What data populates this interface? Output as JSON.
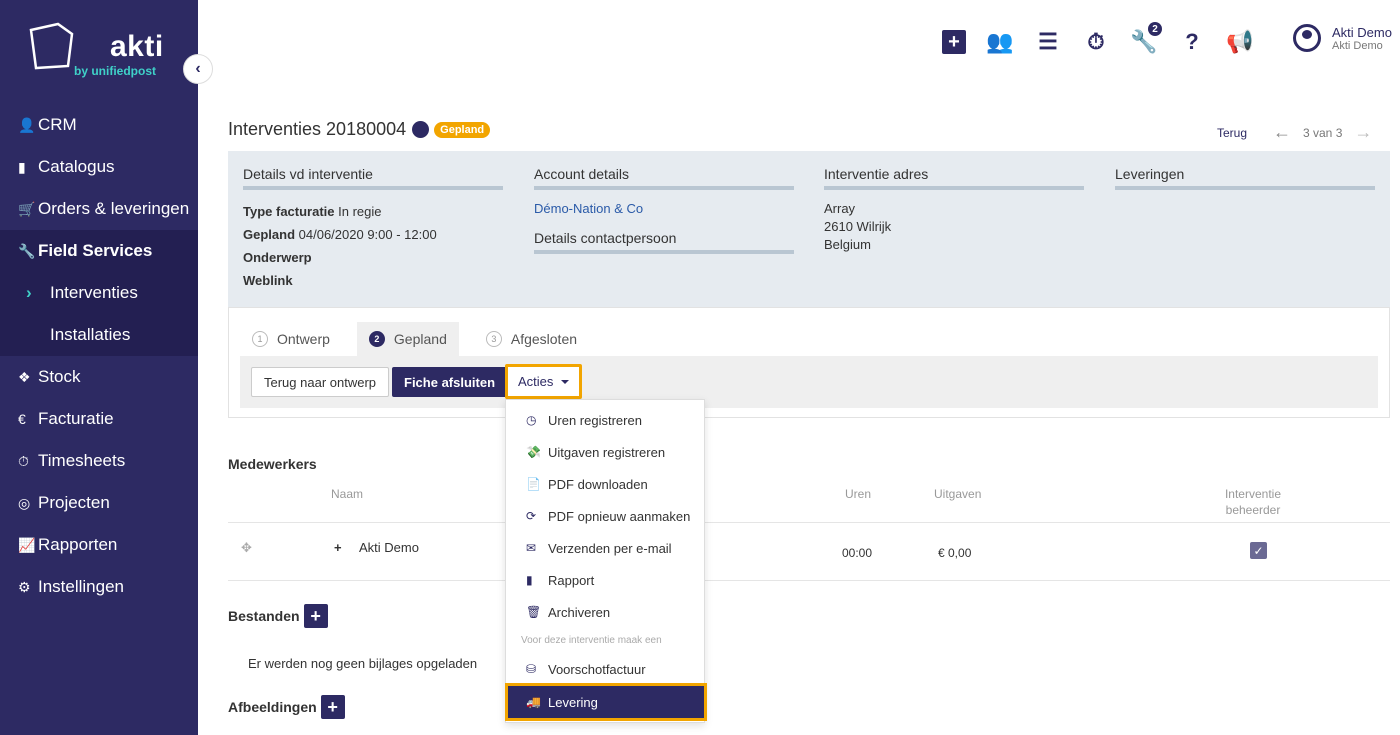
{
  "brand": {
    "name": "akti",
    "tagline": "by unifiedpost"
  },
  "sidebar": {
    "items": [
      {
        "label": "CRM",
        "icon": "user-icon"
      },
      {
        "label": "Catalogus",
        "icon": "book-icon"
      },
      {
        "label": "Orders & leveringen",
        "icon": "cart-icon"
      },
      {
        "label": "Field Services",
        "icon": "wrench-icon"
      },
      {
        "label": "Interventies"
      },
      {
        "label": "Installaties"
      },
      {
        "label": "Stock",
        "icon": "cubes-icon"
      },
      {
        "label": "Facturatie",
        "icon": "euro-icon"
      },
      {
        "label": "Timesheets",
        "icon": "stopwatch-icon"
      },
      {
        "label": "Projecten",
        "icon": "target-icon"
      },
      {
        "label": "Rapporten",
        "icon": "chart-icon"
      },
      {
        "label": "Instellingen",
        "icon": "gear-icon"
      }
    ]
  },
  "topbar": {
    "badge_count": "2",
    "user_name": "Akti Demo",
    "user_company": "Akti Demo"
  },
  "header": {
    "title": "Interventies 20180004",
    "status": "Gepland",
    "back_label": "Terug",
    "pager": "3 van 3"
  },
  "details": {
    "col1_title": "Details vd interventie",
    "type_label": "Type facturatie",
    "type_value": "In regie",
    "planned_label": "Gepland",
    "planned_value": "04/06/2020 9:00 - 12:00",
    "subject_label": "Onderwerp",
    "weblink_label": "Weblink",
    "col2_title": "Account details",
    "account_link": "Démo-Nation & Co",
    "contact_title": "Details contactpersoon",
    "col3_title": "Interventie adres",
    "addr1": "Array",
    "addr2": "2610 Wilrijk",
    "addr3": "Belgium",
    "col4_title": "Leveringen"
  },
  "steps": [
    {
      "num": "1",
      "label": "Ontwerp"
    },
    {
      "num": "2",
      "label": "Gepland"
    },
    {
      "num": "3",
      "label": "Afgesloten"
    }
  ],
  "actions": {
    "back_to_draft": "Terug naar ontwerp",
    "close_sheet": "Fiche afsluiten",
    "acties": "Acties"
  },
  "dropdown": {
    "items": [
      "Uren registreren",
      "Uitgaven registreren",
      "PDF downloaden",
      "PDF opnieuw aanmaken",
      "Verzenden per e-mail",
      "Rapport",
      "Archiveren"
    ],
    "header": "Voor deze interventie maak een",
    "item_advance": "Voorschotfactuur",
    "item_delivery": "Levering"
  },
  "employees": {
    "title": "Medewerkers",
    "col_name": "Naam",
    "col_hours": "Uren",
    "col_expenses": "Uitgaven",
    "col_manager_1": "Interventie",
    "col_manager_2": "beheerder",
    "row_name": "Akti Demo",
    "row_hours": "00:00",
    "row_expenses": "€ 0,00"
  },
  "files": {
    "title": "Bestanden",
    "empty": "Er werden nog geen bijlages opgeladen"
  },
  "images": {
    "title": "Afbeeldingen"
  }
}
